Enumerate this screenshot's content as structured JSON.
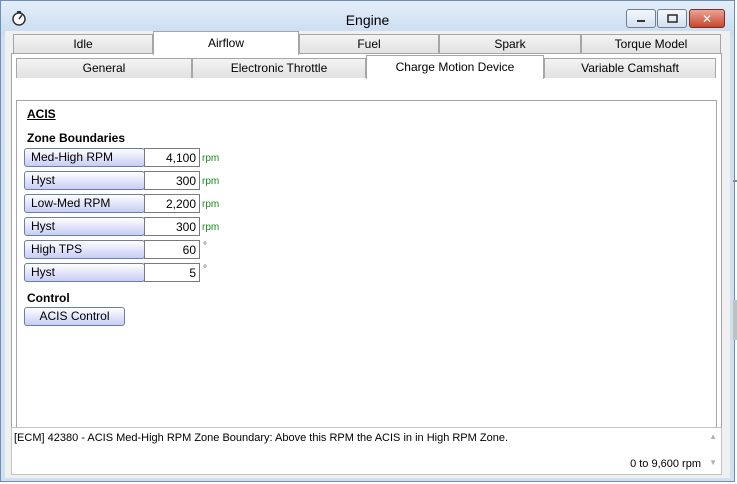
{
  "window": {
    "title": "Engine"
  },
  "main_tabs": [
    {
      "label": "Idle",
      "active": false
    },
    {
      "label": "Airflow",
      "active": true
    },
    {
      "label": "Fuel",
      "active": false
    },
    {
      "label": "Spark",
      "active": false
    },
    {
      "label": "Torque Model",
      "active": false
    }
  ],
  "sub_tabs": [
    {
      "label": "General",
      "active": false
    },
    {
      "label": "Electronic Throttle",
      "active": false
    },
    {
      "label": "Charge Motion Device",
      "active": true
    },
    {
      "label": "Variable Camshaft",
      "active": false
    }
  ],
  "section": {
    "title": "ACIS",
    "zone_heading": "Zone Boundaries",
    "fields": [
      {
        "label": "Med-High RPM",
        "value": "4,100",
        "unit": "rpm"
      },
      {
        "label": "Hyst",
        "value": "300",
        "unit": "rpm"
      },
      {
        "label": "Low-Med RPM",
        "value": "2,200",
        "unit": "rpm"
      },
      {
        "label": "Hyst",
        "value": "300",
        "unit": "rpm"
      },
      {
        "label": "High TPS",
        "value": "60",
        "unit": "°"
      },
      {
        "label": "Hyst",
        "value": "5",
        "unit": "°"
      }
    ],
    "control_heading": "Control",
    "control_button": "ACIS Control"
  },
  "status": {
    "description": "[ECM] 42380 - ACIS Med-High RPM Zone Boundary: Above this RPM the ACIS in in High RPM Zone.",
    "range": "0 to 9,600 rpm"
  },
  "icons": {
    "app": "gauge-icon",
    "minimize": "minimize-icon",
    "maximize": "maximize-icon",
    "close": "close-icon",
    "scroll_up": "scroll-up-icon",
    "scroll_down": "scroll-down-icon"
  },
  "colors": {
    "unit_green": "#1a8a1a",
    "button_gradient_end": "#c8cdf3",
    "close_red": "#c9462c"
  }
}
